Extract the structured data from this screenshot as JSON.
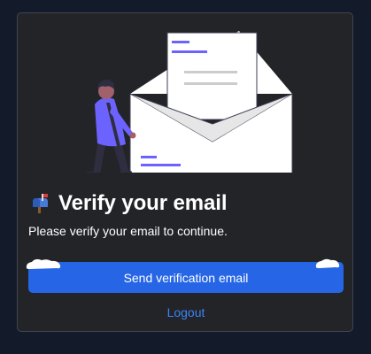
{
  "card": {
    "title": "Verify your email",
    "title_icon": "mailbox-icon",
    "message": "Please verify your email to continue.",
    "send_button_label": "Send verification email",
    "logout_label": "Logout"
  },
  "illustration": {
    "name": "person-with-envelope-illustration"
  },
  "colors": {
    "page_background": "#131a2a",
    "card_background": "#232428",
    "card_border": "#40454f",
    "primary_button": "#2565e6",
    "link": "#3b82f6",
    "illustration_accent": "#6c63ff"
  }
}
